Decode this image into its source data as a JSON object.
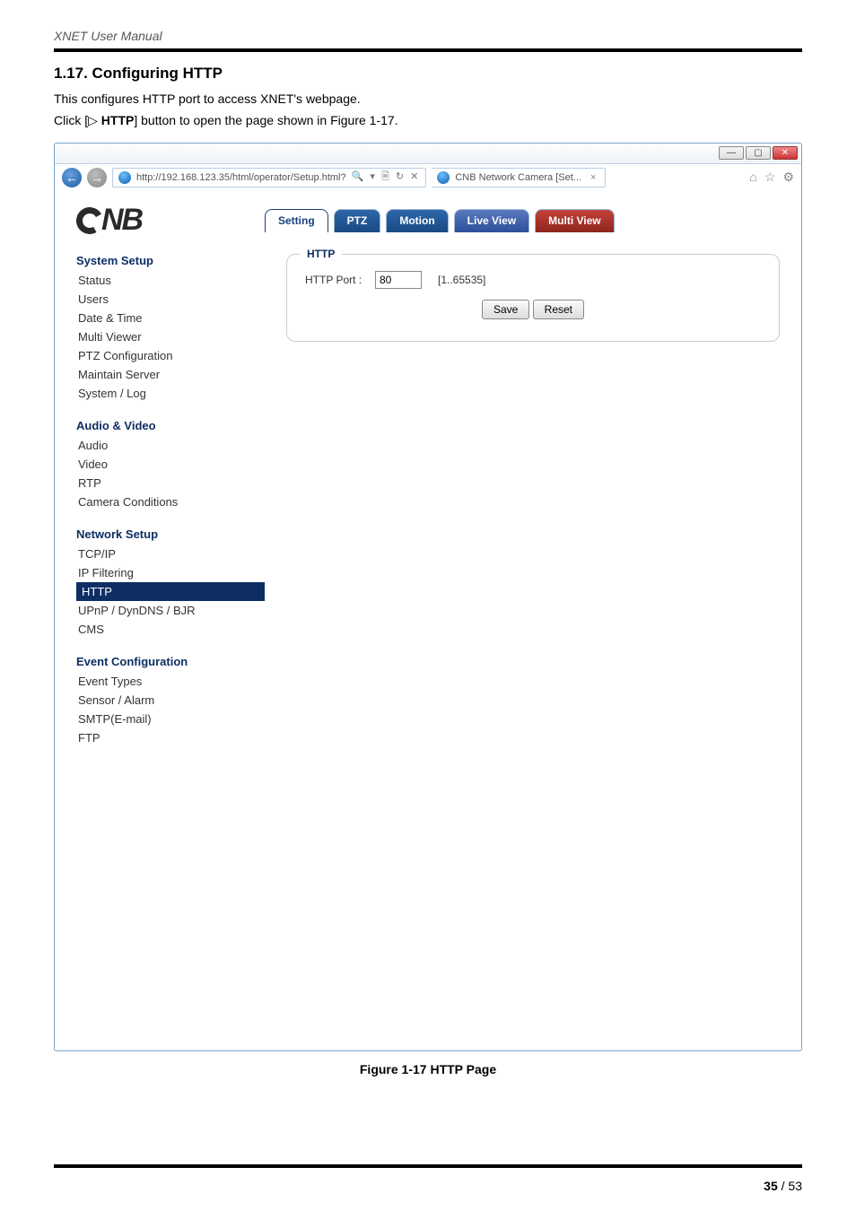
{
  "doc": {
    "header_title": "XNET User Manual",
    "section_number": "1.17.",
    "section_title": "Configuring HTTP",
    "intro_line": "This configures HTTP port to access XNET's webpage.",
    "click_prefix": "Click [",
    "click_icon": "▷",
    "click_bold": " HTTP",
    "click_suffix": "] button to open the page shown in Figure 1-17.",
    "figure_caption": "Figure 1-17 HTTP Page",
    "page_bold": "35",
    "page_sep": " / ",
    "page_total": "53"
  },
  "window": {
    "btn_min": "—",
    "btn_max": "▢",
    "btn_close": "✕",
    "url": "http://192.168.123.35/html/operator/Setup.html?",
    "url_icons": "🔍 ▾ 🗎 ↻ ✕",
    "tab_title": "CNB Network Camera [Set...",
    "tab_close": "×",
    "toolbar_home": "⌂",
    "toolbar_star": "☆",
    "toolbar_gear": "⚙"
  },
  "topnav": {
    "setting": "Setting",
    "ptz": "PTZ",
    "motion": "Motion",
    "live": "Live View",
    "multi": "Multi View"
  },
  "logo_text": "NB",
  "sidebar": {
    "g1_title": "System Setup",
    "g1_items": [
      "Status",
      "Users",
      "Date & Time",
      "Multi Viewer",
      "PTZ Configuration",
      "Maintain Server",
      "System / Log"
    ],
    "g2_title": "Audio & Video",
    "g2_items": [
      "Audio",
      "Video",
      "RTP",
      "Camera Conditions"
    ],
    "g3_title": "Network Setup",
    "g3_items": [
      "TCP/IP",
      "IP Filtering",
      "HTTP",
      "UPnP / DynDNS / BJR",
      "CMS"
    ],
    "g3_active_index": 2,
    "g4_title": "Event Configuration",
    "g4_items": [
      "Event Types",
      "Sensor / Alarm",
      "SMTP(E-mail)",
      "FTP"
    ]
  },
  "panel": {
    "legend": "HTTP",
    "label": "HTTP Port :",
    "value": "80",
    "range": "[1..65535]",
    "save": "Save",
    "reset": "Reset"
  }
}
